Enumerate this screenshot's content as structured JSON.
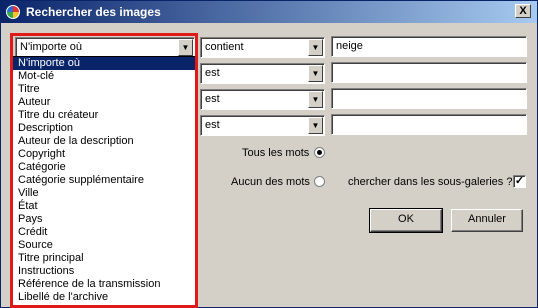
{
  "window": {
    "title": "Rechercher des images",
    "close_label": "X"
  },
  "field_select": {
    "value": "N'importe où",
    "arrow": "▼"
  },
  "rows": [
    {
      "operator": "contient",
      "value": "neige"
    },
    {
      "operator": "est",
      "value": ""
    },
    {
      "operator": "est",
      "value": ""
    },
    {
      "operator": "est",
      "value": ""
    }
  ],
  "dropdown_options": [
    "N'importe où",
    "Mot-clé",
    "Titre",
    "Auteur",
    "Titre du créateur",
    "Description",
    "Auteur de la description",
    "Copyright",
    "Catégorie",
    "Catégorie supplémentaire",
    "Ville",
    "État",
    "Pays",
    "Crédit",
    "Source",
    "Titre principal",
    "Instructions",
    "Référence de la transmission",
    "Libellé de l'archive"
  ],
  "selected_option_index": 0,
  "options": {
    "all_words_label": "Tous les mots",
    "no_words_label": "Aucun des mots",
    "subgalleries_label": "chercher dans les sous-galeries ?",
    "subgalleries_checked": true,
    "checkmark": "✓"
  },
  "buttons": {
    "ok": "OK",
    "cancel": "Annuler"
  },
  "colors": {
    "selection": "#0a246a",
    "highlight_border": "#e01919"
  }
}
